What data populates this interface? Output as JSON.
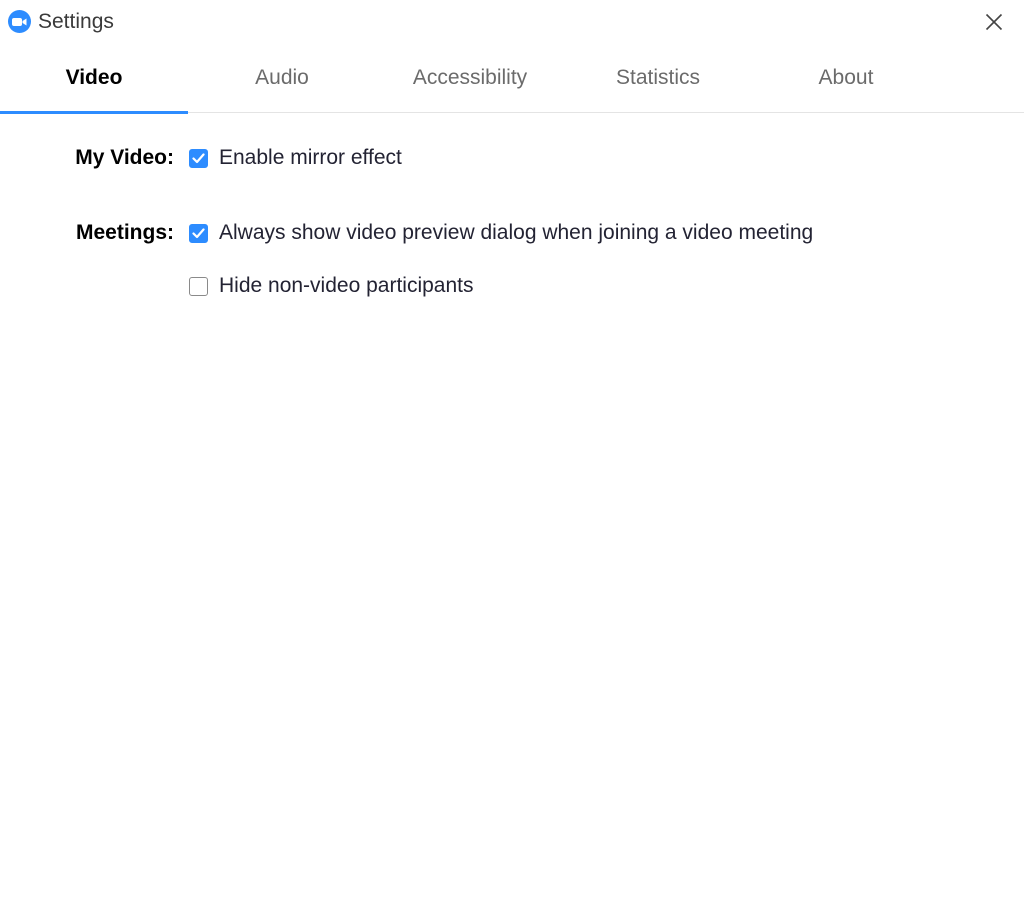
{
  "window": {
    "title": "Settings",
    "app_icon": "zoom-camera-icon",
    "close_icon": "close-icon"
  },
  "tabs": [
    {
      "label": "Video",
      "active": true
    },
    {
      "label": "Audio",
      "active": false
    },
    {
      "label": "Accessibility",
      "active": false
    },
    {
      "label": "Statistics",
      "active": false
    },
    {
      "label": "About",
      "active": false
    }
  ],
  "colors": {
    "accent": "#2d8cff"
  },
  "sections": {
    "my_video": {
      "label": "My Video:",
      "options": [
        {
          "label": "Enable mirror effect",
          "checked": true
        }
      ]
    },
    "meetings": {
      "label": "Meetings:",
      "options": [
        {
          "label": "Always show video preview dialog when joining a video meeting",
          "checked": true
        },
        {
          "label": "Hide non-video participants",
          "checked": false
        }
      ]
    }
  }
}
